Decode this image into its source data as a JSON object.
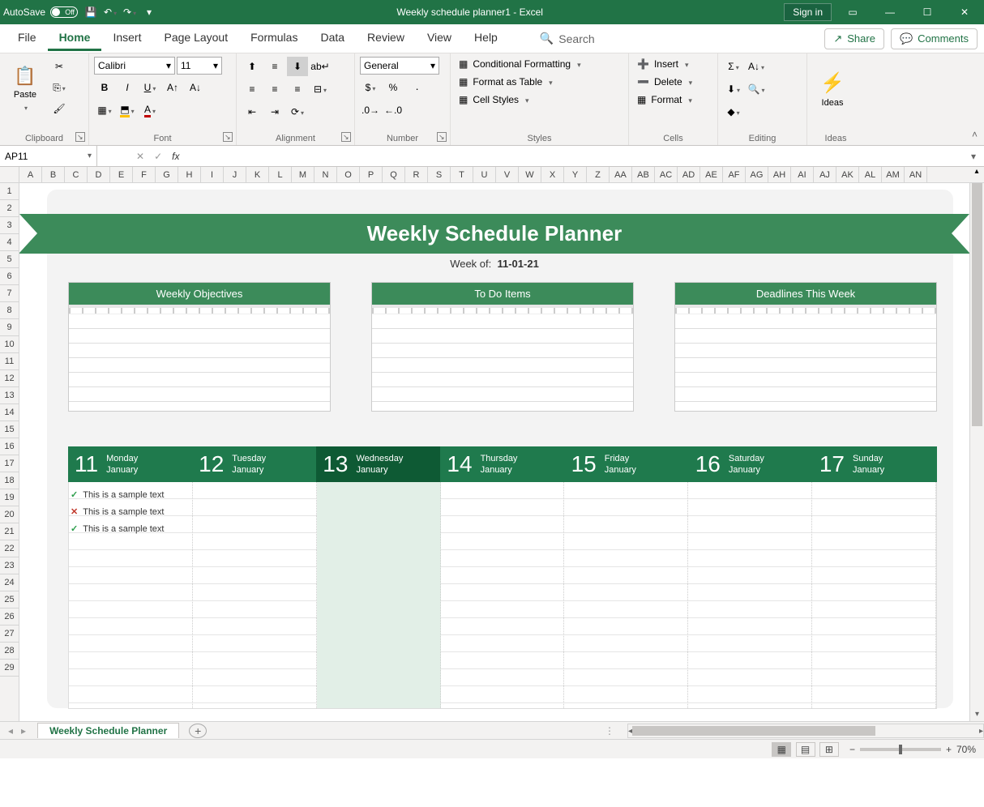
{
  "titlebar": {
    "autosave_label": "AutoSave",
    "autosave_state": "Off",
    "title": "Weekly schedule planner1  -  Excel",
    "signin": "Sign in"
  },
  "menu": {
    "tabs": [
      "File",
      "Home",
      "Insert",
      "Page Layout",
      "Formulas",
      "Data",
      "Review",
      "View",
      "Help"
    ],
    "active": "Home",
    "search": "Search",
    "share": "Share",
    "comments": "Comments"
  },
  "ribbon": {
    "clipboard": {
      "paste": "Paste",
      "label": "Clipboard"
    },
    "font": {
      "family": "Calibri",
      "size": "11",
      "label": "Font"
    },
    "alignment": {
      "label": "Alignment"
    },
    "number": {
      "format": "General",
      "label": "Number"
    },
    "styles": {
      "cf": "Conditional Formatting",
      "fat": "Format as Table",
      "cs": "Cell Styles",
      "label": "Styles"
    },
    "cells": {
      "insert": "Insert",
      "delete": "Delete",
      "format": "Format",
      "label": "Cells"
    },
    "editing": {
      "label": "Editing"
    },
    "ideas": {
      "ideas": "Ideas",
      "label": "Ideas"
    }
  },
  "namebox": {
    "ref": "AP11"
  },
  "columns": [
    "A",
    "B",
    "C",
    "D",
    "E",
    "F",
    "G",
    "H",
    "I",
    "J",
    "K",
    "L",
    "M",
    "N",
    "O",
    "P",
    "Q",
    "R",
    "S",
    "T",
    "U",
    "V",
    "W",
    "X",
    "Y",
    "Z",
    "AA",
    "AB",
    "AC",
    "AD",
    "AE",
    "AF",
    "AG",
    "AH",
    "AI",
    "AJ",
    "AK",
    "AL",
    "AM",
    "AN"
  ],
  "rows": [
    "1",
    "2",
    "3",
    "4",
    "5",
    "6",
    "7",
    "8",
    "9",
    "10",
    "11",
    "12",
    "13",
    "14",
    "15",
    "16",
    "17",
    "18",
    "19",
    "20",
    "21",
    "22",
    "23",
    "24",
    "25",
    "26",
    "27",
    "28",
    "29"
  ],
  "planner": {
    "title": "Weekly Schedule Planner",
    "weekof_label": "Week of:",
    "weekof_value": "11-01-21",
    "boxes": [
      "Weekly Objectives",
      "To Do Items",
      "Deadlines This Week"
    ],
    "days": [
      {
        "num": "11",
        "dow": "Monday",
        "mon": "January"
      },
      {
        "num": "12",
        "dow": "Tuesday",
        "mon": "January"
      },
      {
        "num": "13",
        "dow": "Wednesday",
        "mon": "January"
      },
      {
        "num": "14",
        "dow": "Thursday",
        "mon": "January"
      },
      {
        "num": "15",
        "dow": "Friday",
        "mon": "January"
      },
      {
        "num": "16",
        "dow": "Saturday",
        "mon": "January"
      },
      {
        "num": "17",
        "dow": "Sunday",
        "mon": "January"
      }
    ],
    "today_index": 2,
    "tasks": [
      {
        "mark": "check",
        "text": "This is a sample text"
      },
      {
        "mark": "x",
        "text": "This is a sample text"
      },
      {
        "mark": "check",
        "text": "This is a sample text"
      }
    ]
  },
  "sheettab": "Weekly Schedule Planner",
  "zoom": "70%"
}
